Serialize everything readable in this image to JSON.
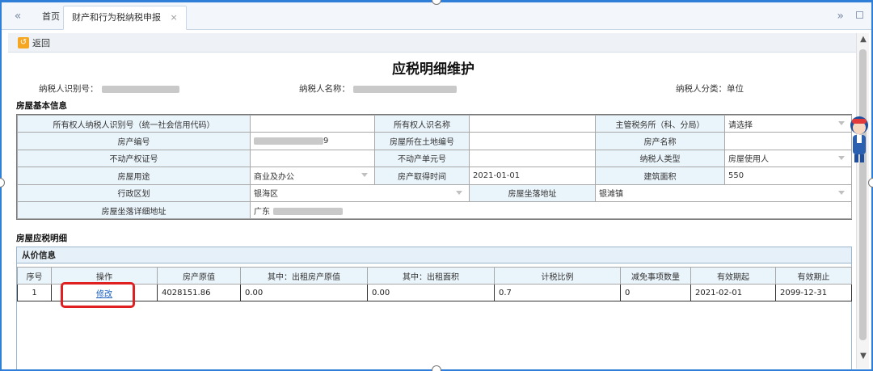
{
  "tabs": {
    "prev_icon": "«",
    "home": "首页",
    "active": "财产和行为税纳税申报",
    "close_icon": "×",
    "next_icon": "»"
  },
  "toolbar": {
    "back_label": "返回"
  },
  "page": {
    "title": "应税明细维护",
    "taxpayer_id_label": "纳税人识别号：",
    "taxpayer_name_label": "纳税人名称：",
    "taxpayer_category_label": "纳税人分类：",
    "taxpayer_category_value": "单位"
  },
  "house_basic": {
    "section_title": "房屋基本信息",
    "owner_id_label": "所有权人纳税人识别号（统一社会信用代码）",
    "owner_id_value": "",
    "owner_name_label": "所有权人识名称",
    "owner_name_value": "",
    "tax_office_label": "主管税务所（科、分局）",
    "tax_office_value": "请选择",
    "property_no_label": "房产编号",
    "property_no_value": "9",
    "land_no_label": "房屋所在土地编号",
    "land_no_value": "",
    "property_name_label": "房产名称",
    "property_name_value": "",
    "cert_no_label": "不动产权证号",
    "cert_no_value": "",
    "unit_no_label": "不动产单元号",
    "unit_no_value": "",
    "taxpayer_type_label": "纳税人类型",
    "taxpayer_type_value": "房屋使用人",
    "usage_label": "房屋用途",
    "usage_value": "商业及办公",
    "acquire_time_label": "房产取得时间",
    "acquire_time_value": "2021-01-01",
    "area_label": "建筑面积",
    "area_value": "550",
    "district_label": "行政区划",
    "district_value": "银海区",
    "location_label": "房屋坐落地址",
    "location_value": "银滩镇",
    "detail_addr_label": "房屋坐落详细地址",
    "detail_addr_value": "广东"
  },
  "detail": {
    "section_title": "房屋应税明细",
    "panel_title": "从价信息",
    "headers": [
      "序号",
      "操作",
      "房产原值",
      "其中：出租房产原值",
      "其中：出租面积",
      "计税比例",
      "减免事项数量",
      "有效期起",
      "有效期止"
    ],
    "row": {
      "no": "1",
      "action": "修改",
      "original_value": "4028151.86",
      "rented_value": "0.00",
      "rented_area": "0.00",
      "tax_ratio": "0.7",
      "relief_count": "0",
      "valid_from": "2021-02-01",
      "valid_to": "2099-12-31"
    }
  },
  "colors": {
    "frame": "#2f7fd8",
    "label_bg": "#eaf4fb",
    "highlight": "#e02020",
    "back_icon": "#f5a623"
  }
}
